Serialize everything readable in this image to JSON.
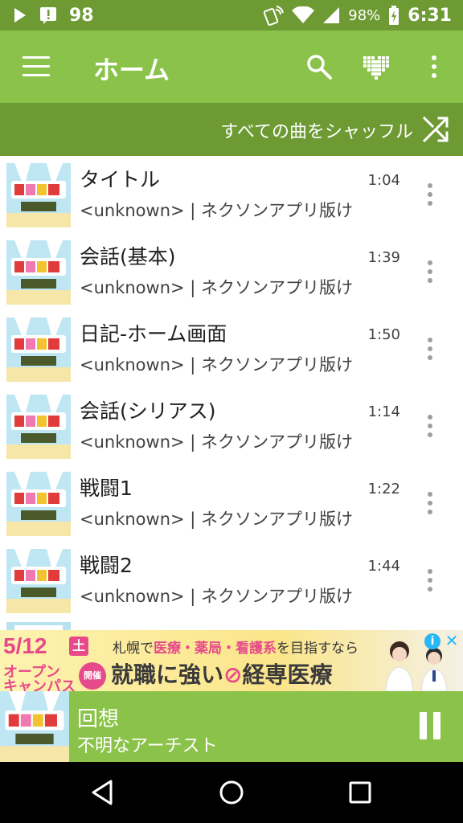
{
  "status_bar": {
    "notification_count": "98",
    "battery": "98%",
    "time": "6:31",
    "icons": [
      "play-icon",
      "alert-icon",
      "nfc-icon",
      "wifi-icon",
      "signal-icon",
      "battery-icon"
    ]
  },
  "app_bar": {
    "title": "ホーム",
    "icons": [
      "menu-icon",
      "search-icon",
      "heart-icon",
      "more-vert-icon"
    ]
  },
  "shuffle": {
    "label": "すべての曲をシャッフル",
    "icon": "shuffle-icon"
  },
  "tracks": [
    {
      "title": "タイトル",
      "subtitle": "<unknown> | ネクソンアプリ版け",
      "duration": "1:04"
    },
    {
      "title": "会話(基本)",
      "subtitle": "<unknown> | ネクソンアプリ版け",
      "duration": "1:39"
    },
    {
      "title": "日記-ホーム画面",
      "subtitle": "<unknown> | ネクソンアプリ版け",
      "duration": "1:50"
    },
    {
      "title": "会話(シリアス)",
      "subtitle": "<unknown> | ネクソンアプリ版け",
      "duration": "1:14"
    },
    {
      "title": "戦闘1",
      "subtitle": "<unknown> | ネクソンアプリ版け",
      "duration": "1:22"
    },
    {
      "title": "戦闘2",
      "subtitle": "<unknown> | ネクソンアプリ版け",
      "duration": "1:44"
    }
  ],
  "ad": {
    "date": "5/12",
    "day": "土",
    "campus_line1": "オープン",
    "campus_line2": "キャンパス",
    "badge": "開催",
    "line1_a": "札幌で",
    "line1_b": "医療・薬局・看護系",
    "line1_c": "を目指すなら",
    "line2_a": "就職に強い",
    "line2_b": "経専医療",
    "info": "i",
    "close": "✕"
  },
  "now_playing": {
    "title": "回想",
    "artist": "不明なアーチスト",
    "state": "playing"
  },
  "colors": {
    "status_bar": "#6e9a34",
    "app_bar": "#8bc34a",
    "shuffle_bar": "#6e9a34",
    "now_playing": "#8bc34a",
    "accent_pink": "#e64a8a"
  }
}
